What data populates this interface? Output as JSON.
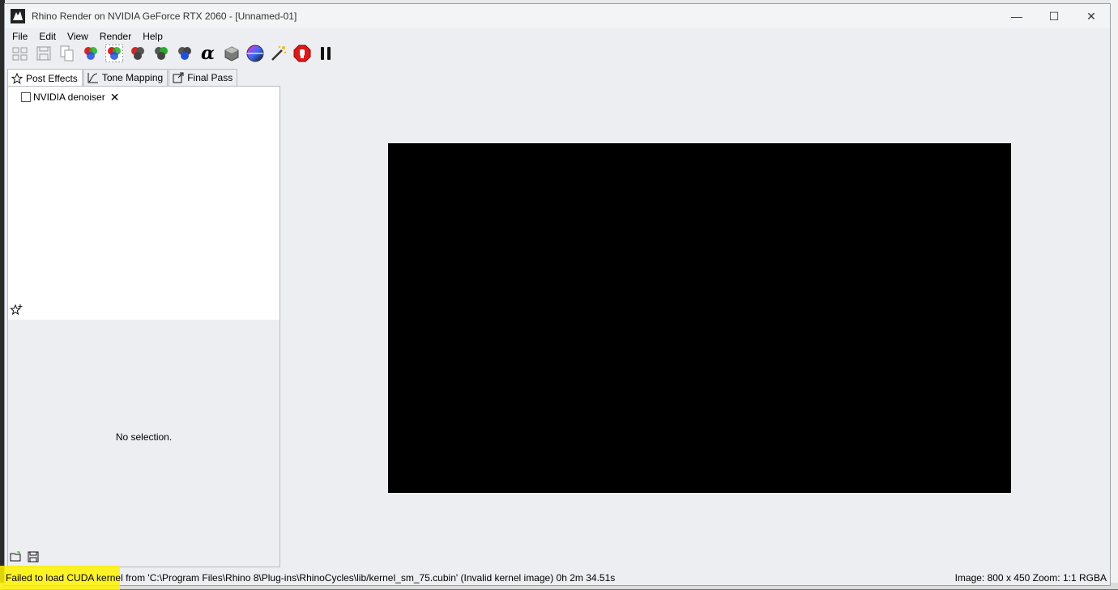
{
  "window": {
    "title": "Rhino Render on NVIDIA GeForce RTX 2060 - [Unnamed-01]",
    "controls": {
      "minimize": "—",
      "maximize": "☐",
      "close": "✕"
    }
  },
  "menu": [
    "File",
    "Edit",
    "View",
    "Render",
    "Help"
  ],
  "toolbar": {
    "icons": [
      "group-icon",
      "save-icon",
      "copy-icon",
      "color-channels-icon",
      "channels-grid-icon",
      "red-channel-icon",
      "green-channel-icon",
      "blue-channel-icon",
      "alpha-icon",
      "box-icon",
      "color-wheel-icon",
      "magic-wand-icon",
      "stop-render-icon",
      "pause-icon"
    ],
    "alpha_glyph": "α"
  },
  "tabs": [
    {
      "label": "Post Effects",
      "active": true
    },
    {
      "label": "Tone Mapping",
      "active": false
    },
    {
      "label": "Final Pass",
      "active": false
    }
  ],
  "post_effects": {
    "items": [
      {
        "label": "NVIDIA denoiser",
        "checked": false
      }
    ],
    "remove_glyph": "✕"
  },
  "properties": {
    "empty_text": "No selection."
  },
  "status": {
    "message": "Failed to load CUDA kernel from 'C:\\Program Files\\Rhino 8\\Plug-ins\\RhinoCycles\\lib/kernel_sm_75.cubin' (Invalid kernel image) 0h 2m 34.51s",
    "image_info": "Image: 800 x 450  Zoom: 1:1  RGBA"
  },
  "colors": {
    "highlight": "#fff200",
    "render_bg": "#000000",
    "window_bg": "#eceef2"
  }
}
